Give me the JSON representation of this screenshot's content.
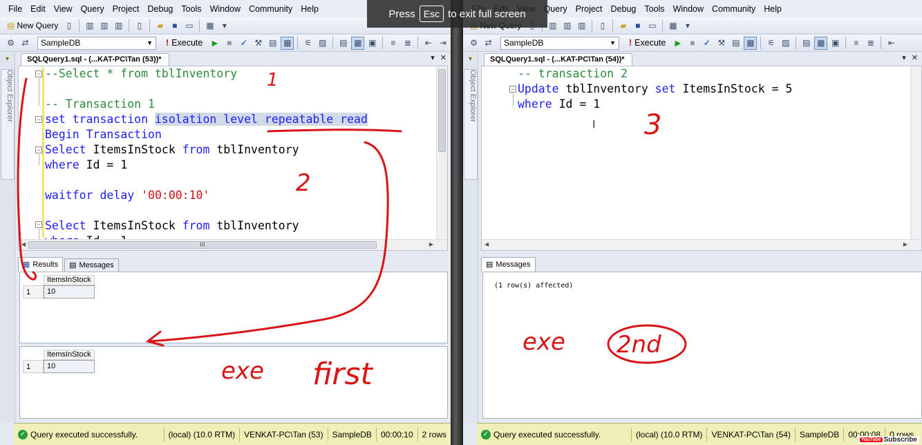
{
  "menu": [
    "File",
    "Edit",
    "View",
    "Query",
    "Project",
    "Debug",
    "Tools",
    "Window",
    "Community",
    "Help"
  ],
  "toolbar": {
    "new_query": "New Query",
    "database": "SampleDB",
    "execute": "Execute"
  },
  "side_panel": {
    "label": "Object Explorer"
  },
  "fullscreen": {
    "press": "Press",
    "key": "Esc",
    "message": "to exit full screen"
  },
  "left": {
    "tab_title": "SQLQuery1.sql - (...KAT-PC\\Tan (53))*",
    "results_tabs": [
      "Results",
      "Messages"
    ],
    "grids": [
      {
        "column": "ItemsInStock",
        "row_number": "1",
        "value": "10"
      },
      {
        "column": "ItemsInStock",
        "row_number": "1",
        "value": "10"
      }
    ],
    "status": {
      "message": "Query executed successfully.",
      "server": "(local) (10.0 RTM)",
      "user": "VENKAT-PC\\Tan (53)",
      "database": "SampleDB",
      "elapsed": "00:00:10",
      "rows": "2 rows"
    }
  },
  "right": {
    "tab_title": "SQLQuery1.sql - (...KAT-PC\\Tan (54))*",
    "messages_tab": "Messages",
    "message_text": "(1 row(s) affected)",
    "status": {
      "message": "Query executed successfully.",
      "server": "(local) (10.0 RTM)",
      "user": "VENKAT-PC\\Tan (54)",
      "database": "SampleDB",
      "elapsed": "00:00:08",
      "rows": "0 rows"
    }
  },
  "annotations": [
    "1",
    "2",
    "3",
    "exe",
    "first",
    "exe",
    "2nd"
  ],
  "subscribe": {
    "badge": "YouTube",
    "label": "Subscribe"
  },
  "scrollbar": {
    "grip": "III"
  }
}
